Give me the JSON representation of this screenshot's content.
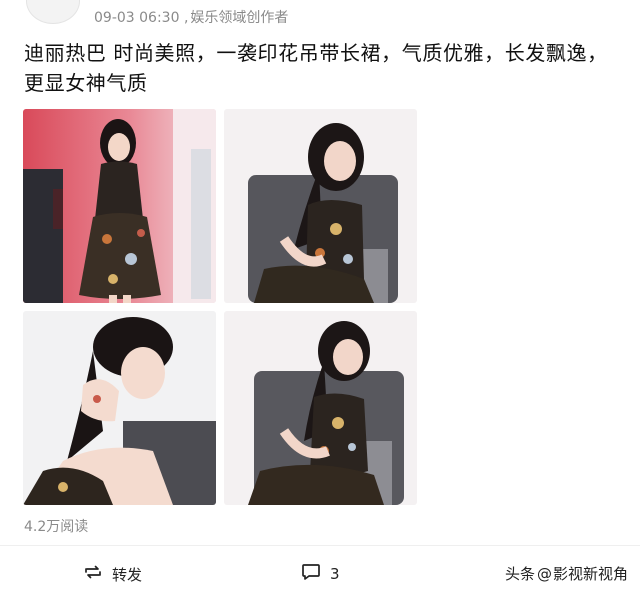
{
  "post": {
    "date_time": "09-03 06:30",
    "source": "娱乐领域创作者",
    "separator": ",",
    "text": "迪丽热巴 时尚美照，一袭印花吊带长裙，气质优雅，长发飘逸，更显女神气质",
    "reads": "4.2万阅读"
  },
  "photos": [
    {
      "description_id": "photo-1"
    },
    {
      "description_id": "photo-2"
    },
    {
      "description_id": "photo-3"
    },
    {
      "description_id": "photo-4"
    }
  ],
  "actions": {
    "share_label": "转发",
    "comment_count": "3"
  },
  "watermark": {
    "brand": "头条",
    "at": "@",
    "account": "影视新视角"
  },
  "colors": {
    "meta_gray": "#8a8a8a",
    "text": "#111111",
    "divider": "#efefef"
  },
  "icons": [
    "repost-icon",
    "comment-icon",
    "avatar"
  ]
}
